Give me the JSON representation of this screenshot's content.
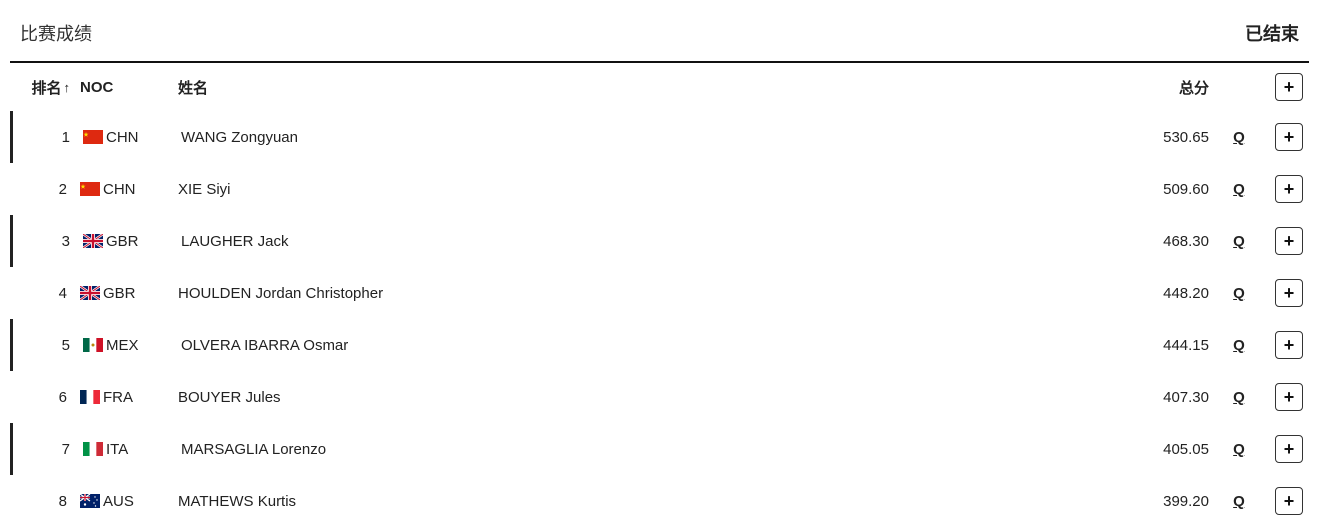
{
  "header": {
    "title": "比赛成绩",
    "status": "已结束"
  },
  "columns": {
    "rank": "排名",
    "sort_indicator": "↑",
    "noc": "NOC",
    "name": "姓名",
    "total": "总分"
  },
  "expand_icon": "+",
  "results": [
    {
      "rank": 1,
      "noc": "CHN",
      "flag": "CHN",
      "name": "WANG Zongyuan",
      "total": "530.65",
      "q": "Q",
      "group_start": true
    },
    {
      "rank": 2,
      "noc": "CHN",
      "flag": "CHN",
      "name": "XIE Siyi",
      "total": "509.60",
      "q": "Q",
      "group_start": false
    },
    {
      "rank": 3,
      "noc": "GBR",
      "flag": "GBR",
      "name": "LAUGHER Jack",
      "total": "468.30",
      "q": "Q",
      "group_start": true
    },
    {
      "rank": 4,
      "noc": "GBR",
      "flag": "GBR",
      "name": "HOULDEN Jordan Christopher",
      "total": "448.20",
      "q": "Q",
      "group_start": false
    },
    {
      "rank": 5,
      "noc": "MEX",
      "flag": "MEX",
      "name": "OLVERA IBARRA Osmar",
      "total": "444.15",
      "q": "Q",
      "group_start": true
    },
    {
      "rank": 6,
      "noc": "FRA",
      "flag": "FRA",
      "name": "BOUYER Jules",
      "total": "407.30",
      "q": "Q",
      "group_start": false
    },
    {
      "rank": 7,
      "noc": "ITA",
      "flag": "ITA",
      "name": "MARSAGLIA Lorenzo",
      "total": "405.05",
      "q": "Q",
      "group_start": true
    },
    {
      "rank": 8,
      "noc": "AUS",
      "flag": "AUS",
      "name": "MATHEWS Kurtis",
      "total": "399.20",
      "q": "Q",
      "group_start": false
    }
  ]
}
